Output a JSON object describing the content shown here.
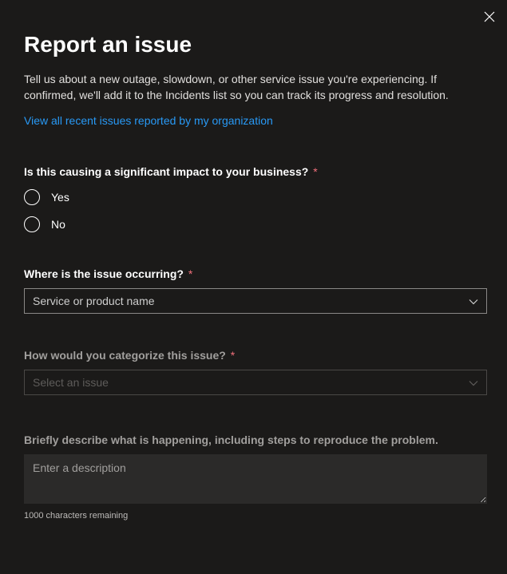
{
  "dialog": {
    "title": "Report an issue",
    "intro": "Tell us about a new outage, slowdown, or other service issue you're experiencing. If confirmed, we'll add it to the Incidents list so you can track its progress and resolution.",
    "link": "View all recent issues reported by my organization"
  },
  "impact": {
    "label": "Is this causing a significant impact to your business?",
    "required": "*",
    "yes": "Yes",
    "no": "No"
  },
  "location": {
    "label": "Where is the issue occurring?",
    "required": "*",
    "placeholder": "Service or product name"
  },
  "category": {
    "label": "How would you categorize this issue?",
    "required": "*",
    "placeholder": "Select an issue"
  },
  "description": {
    "label": "Briefly describe what is happening, including steps to reproduce the problem.",
    "placeholder": "Enter a description",
    "char_count": "1000 characters remaining"
  }
}
